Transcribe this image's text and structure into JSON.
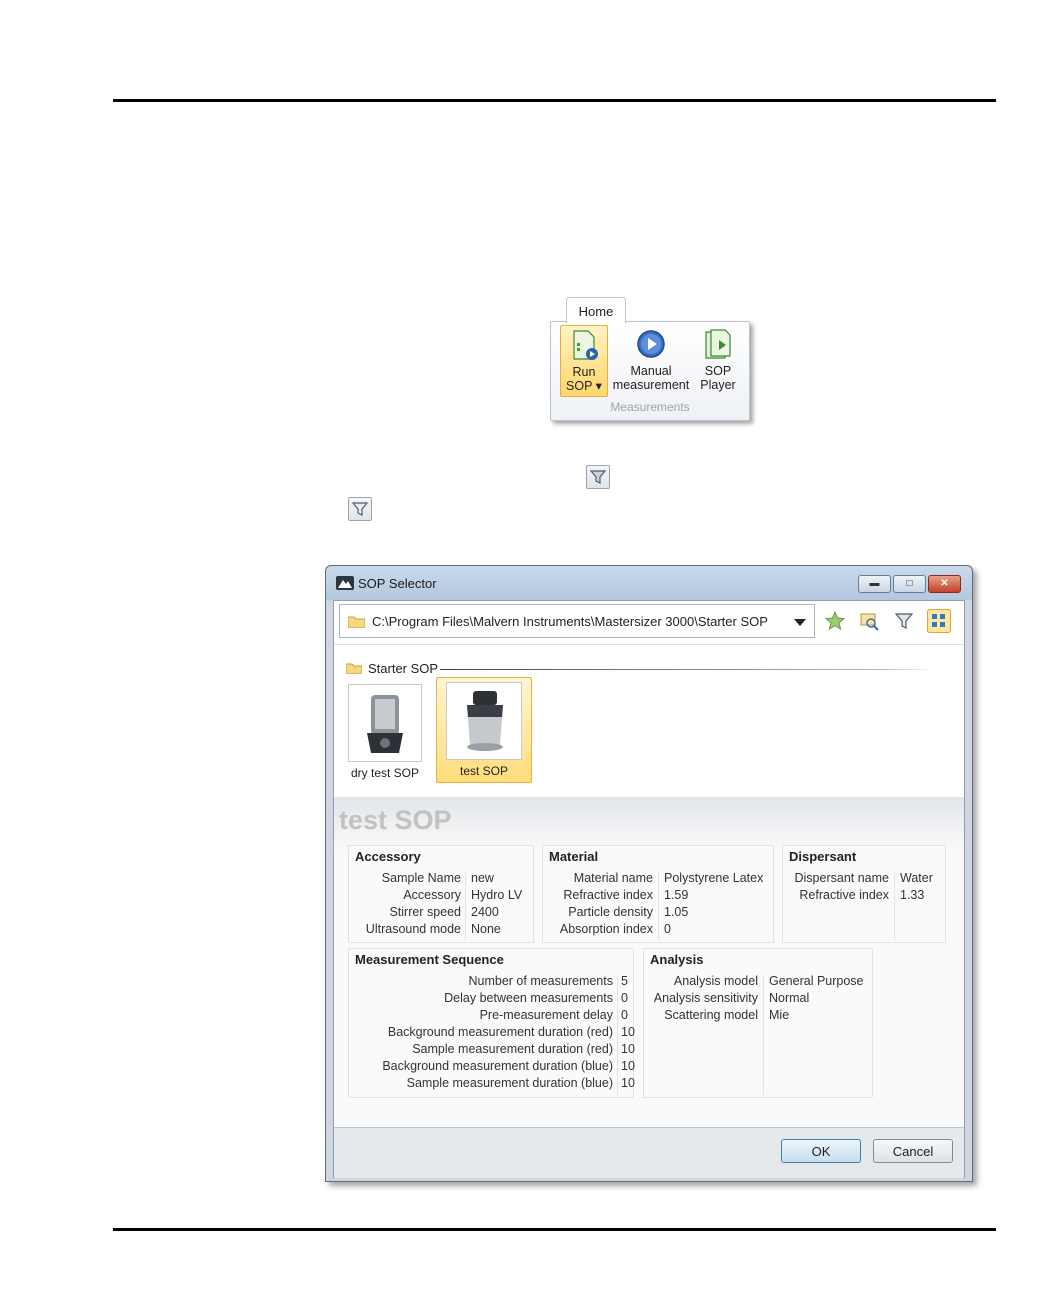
{
  "ribbon": {
    "tab_label": "Home",
    "buttons": [
      {
        "label_line1": "Run",
        "label_line2": "SOP ▾",
        "icon": "run-sop-icon",
        "selected": true
      },
      {
        "label_line1": "Manual",
        "label_line2": "measurement",
        "icon": "play-circle-icon",
        "selected": false
      },
      {
        "label_line1": "SOP",
        "label_line2": "Player",
        "icon": "sop-player-icon",
        "selected": false
      }
    ],
    "group_label": "Measurements"
  },
  "dialog": {
    "title": "SOP Selector",
    "path": "C:\\Program Files\\Malvern Instruments\\Mastersizer 3000\\Starter SOP",
    "section_label": "Starter SOP",
    "sops": [
      {
        "name": "dry test SOP",
        "selected": false
      },
      {
        "name": "test SOP",
        "selected": true
      }
    ],
    "detail_title": "test SOP",
    "accessory": {
      "title": "Accessory",
      "rows": [
        {
          "k": "Sample Name",
          "v": "new"
        },
        {
          "k": "Accessory",
          "v": "Hydro LV"
        },
        {
          "k": "Stirrer speed",
          "v": "2400"
        },
        {
          "k": "Ultrasound mode",
          "v": "None"
        }
      ]
    },
    "material": {
      "title": "Material",
      "rows": [
        {
          "k": "Material name",
          "v": "Polystyrene Latex"
        },
        {
          "k": "Refractive index",
          "v": "1.59"
        },
        {
          "k": "Particle density",
          "v": "1.05"
        },
        {
          "k": "Absorption index",
          "v": "0"
        }
      ]
    },
    "dispersant": {
      "title": "Dispersant",
      "rows": [
        {
          "k": "Dispersant name",
          "v": "Water"
        },
        {
          "k": "Refractive index",
          "v": "1.33"
        }
      ]
    },
    "sequence": {
      "title": "Measurement Sequence",
      "rows": [
        {
          "k": "Number of measurements",
          "v": "5"
        },
        {
          "k": "Delay between measurements",
          "v": "0"
        },
        {
          "k": "Pre-measurement delay",
          "v": "0"
        },
        {
          "k": "Background measurement duration (red)",
          "v": "10"
        },
        {
          "k": "Sample measurement duration (red)",
          "v": "10"
        },
        {
          "k": "Background measurement duration (blue)",
          "v": "10"
        },
        {
          "k": "Sample measurement duration (blue)",
          "v": "10"
        }
      ]
    },
    "analysis": {
      "title": "Analysis",
      "rows": [
        {
          "k": "Analysis model",
          "v": "General Purpose"
        },
        {
          "k": "Analysis sensitivity",
          "v": "Normal"
        },
        {
          "k": "Scattering model",
          "v": "Mie"
        }
      ]
    },
    "ok_label": "OK",
    "cancel_label": "Cancel"
  }
}
